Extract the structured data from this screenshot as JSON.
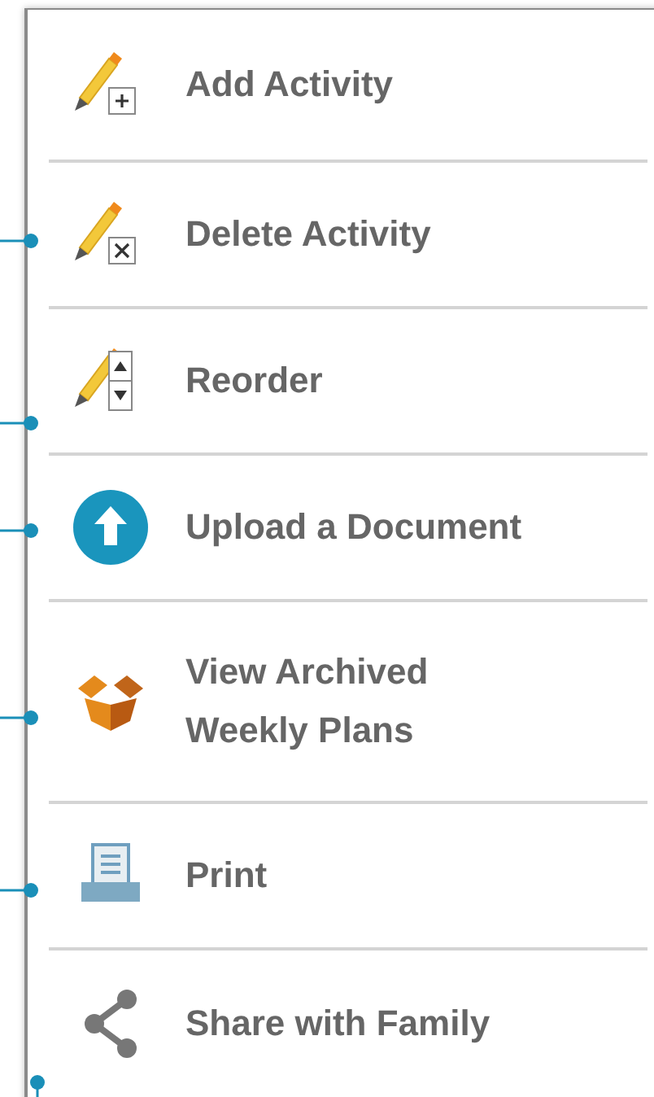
{
  "menu": {
    "items": [
      {
        "kind": "add",
        "label": "Add Activity"
      },
      {
        "kind": "delete",
        "label": "Delete Activity"
      },
      {
        "kind": "reorder",
        "label": "Reorder"
      },
      {
        "kind": "upload",
        "label": "Upload a Document"
      },
      {
        "kind": "archive",
        "label": "View Archived Weekly Plans"
      },
      {
        "kind": "print",
        "label": "Print"
      },
      {
        "kind": "share",
        "label": "Share with Family"
      }
    ]
  }
}
